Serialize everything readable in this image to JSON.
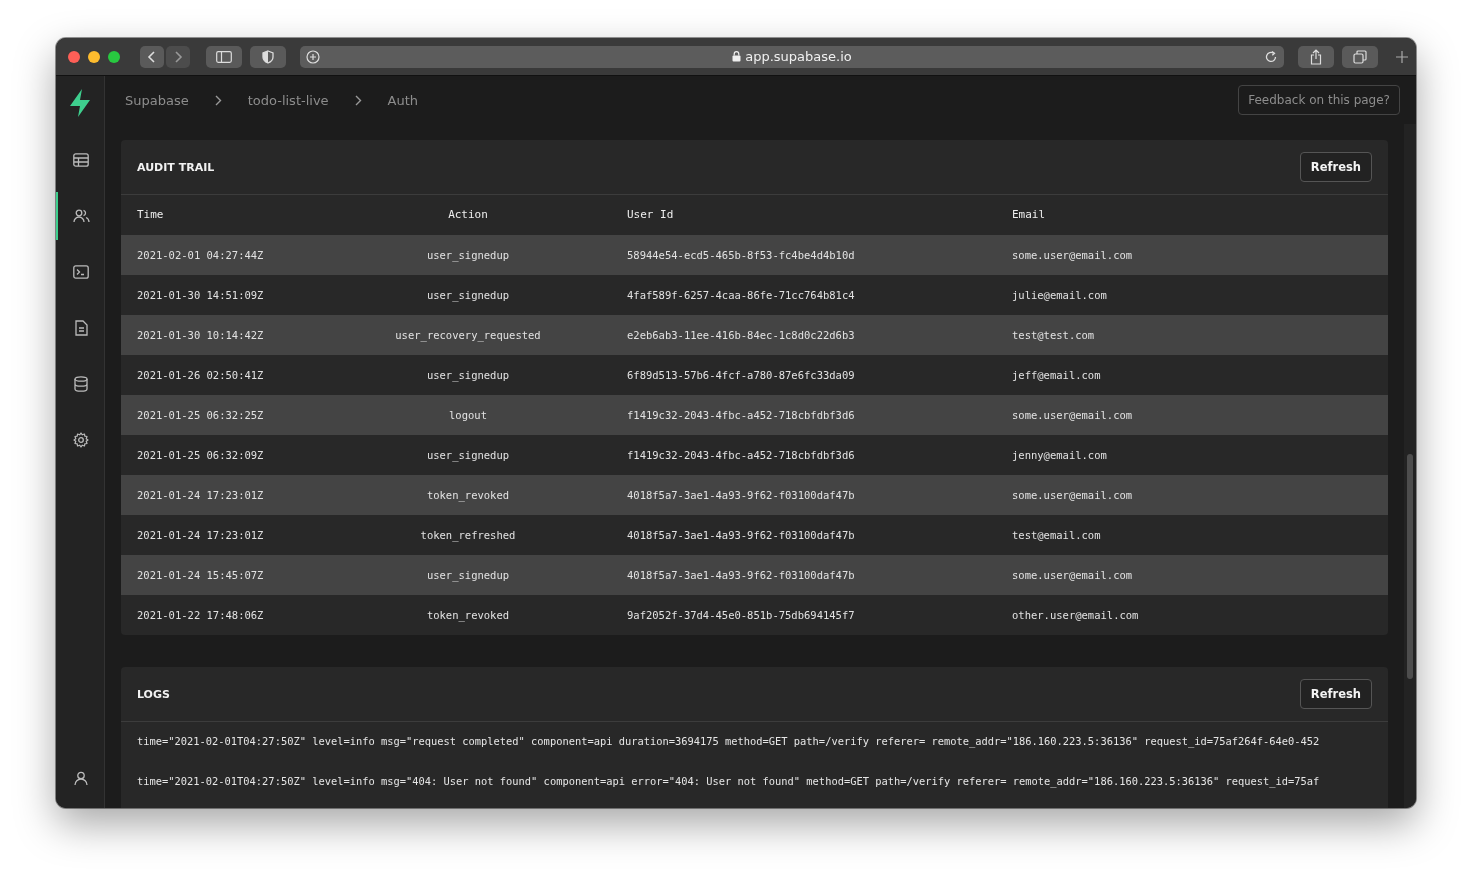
{
  "browser": {
    "url": "app.supabase.io"
  },
  "sidebar": {
    "items": [
      {
        "selected": false
      },
      {
        "selected": true
      },
      {
        "selected": false
      },
      {
        "selected": false
      },
      {
        "selected": false
      },
      {
        "selected": false
      }
    ]
  },
  "breadcrumbs": [
    "Supabase",
    "todo-list-live",
    "Auth"
  ],
  "feedback_button": "Feedback on this page?",
  "audit_trail": {
    "title": "AUDIT TRAIL",
    "refresh": "Refresh",
    "columns": [
      "Time",
      "Action",
      "User Id",
      "Email"
    ],
    "rows": [
      [
        "2021-02-01 04:27:44Z",
        "user_signedup",
        "58944e54-ecd5-465b-8f53-fc4be4d4b10d",
        "some.user@email.com"
      ],
      [
        "2021-01-30 14:51:09Z",
        "user_signedup",
        "4faf589f-6257-4caa-86fe-71cc764b81c4",
        "julie@email.com"
      ],
      [
        "2021-01-30 10:14:42Z",
        "user_recovery_requested",
        "e2eb6ab3-11ee-416b-84ec-1c8d0c22d6b3",
        "test@test.com"
      ],
      [
        "2021-01-26 02:50:41Z",
        "user_signedup",
        "6f89d513-57b6-4fcf-a780-87e6fc33da09",
        "jeff@email.com"
      ],
      [
        "2021-01-25 06:32:25Z",
        "logout",
        "f1419c32-2043-4fbc-a452-718cbfdbf3d6",
        "some.user@email.com"
      ],
      [
        "2021-01-25 06:32:09Z",
        "user_signedup",
        "f1419c32-2043-4fbc-a452-718cbfdbf3d6",
        "jenny@email.com"
      ],
      [
        "2021-01-24 17:23:01Z",
        "token_revoked",
        "4018f5a7-3ae1-4a93-9f62-f03100daf47b",
        "some.user@email.com"
      ],
      [
        "2021-01-24 17:23:01Z",
        "token_refreshed",
        "4018f5a7-3ae1-4a93-9f62-f03100daf47b",
        "test@email.com"
      ],
      [
        "2021-01-24 15:45:07Z",
        "user_signedup",
        "4018f5a7-3ae1-4a93-9f62-f03100daf47b",
        "some.user@email.com"
      ],
      [
        "2021-01-22 17:48:06Z",
        "token_revoked",
        "9af2052f-37d4-45e0-851b-75db694145f7",
        "other.user@email.com"
      ]
    ]
  },
  "logs": {
    "title": "LOGS",
    "refresh": "Refresh",
    "lines": [
      "time=\"2021-02-01T04:27:50Z\" level=info msg=\"request completed\" component=api duration=3694175 method=GET path=/verify referer= remote_addr=\"186.160.223.5:36136\" request_id=75af264f-64e0-452",
      "time=\"2021-02-01T04:27:50Z\" level=info msg=\"404: User not found\" component=api error=\"404: User not found\" method=GET path=/verify referer= remote_addr=\"186.160.223.5:36136\" request_id=75af"
    ]
  }
}
